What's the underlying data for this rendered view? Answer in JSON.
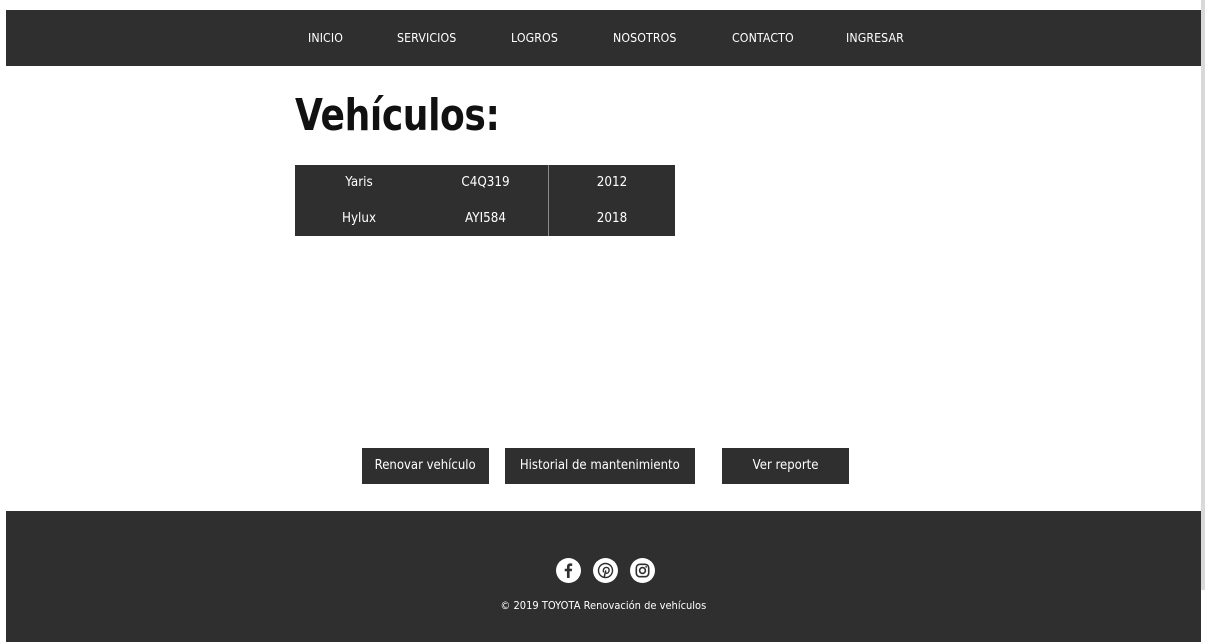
{
  "nav": {
    "items": [
      {
        "label": "INICIO"
      },
      {
        "label": "SERVICIOS"
      },
      {
        "label": "LOGROS"
      },
      {
        "label": "NOSOTROS"
      },
      {
        "label": "CONTACTO"
      },
      {
        "label": "INGRESAR"
      }
    ]
  },
  "page": {
    "title": "Vehículos:"
  },
  "vehicles": {
    "rows": [
      {
        "model": "Yaris",
        "plate": "C4Q319",
        "year": "2012"
      },
      {
        "model": "Hylux",
        "plate": "AYI584",
        "year": "2018"
      }
    ]
  },
  "actions": {
    "renew": "Renovar vehículo",
    "history": "Historial de mantenimiento",
    "report": "Ver reporte"
  },
  "footer": {
    "social": [
      "facebook-icon",
      "pinterest-icon",
      "instagram-icon"
    ],
    "copyright": "© 2019 TOYOTA Renovación de vehículos"
  },
  "colors": {
    "bar": "#2f2f2f",
    "text_on_bar": "#ffffff",
    "title": "#111111"
  }
}
